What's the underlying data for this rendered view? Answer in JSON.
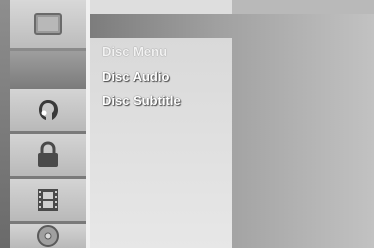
{
  "sidebar": {
    "items": [
      {
        "name": "disc-icon-top",
        "icon": "screen-icon"
      },
      {
        "name": "language-icon",
        "icon": "person-head-icon"
      },
      {
        "name": "lock-icon",
        "icon": "padlock-icon"
      },
      {
        "name": "film-icon",
        "icon": "film-strip-icon"
      },
      {
        "name": "disc-icon",
        "icon": "disc-icon"
      }
    ]
  },
  "menu": {
    "items": [
      {
        "label": "Disc Menu"
      },
      {
        "label": "Disc Audio"
      },
      {
        "label": "Disc Subtitle"
      }
    ]
  }
}
